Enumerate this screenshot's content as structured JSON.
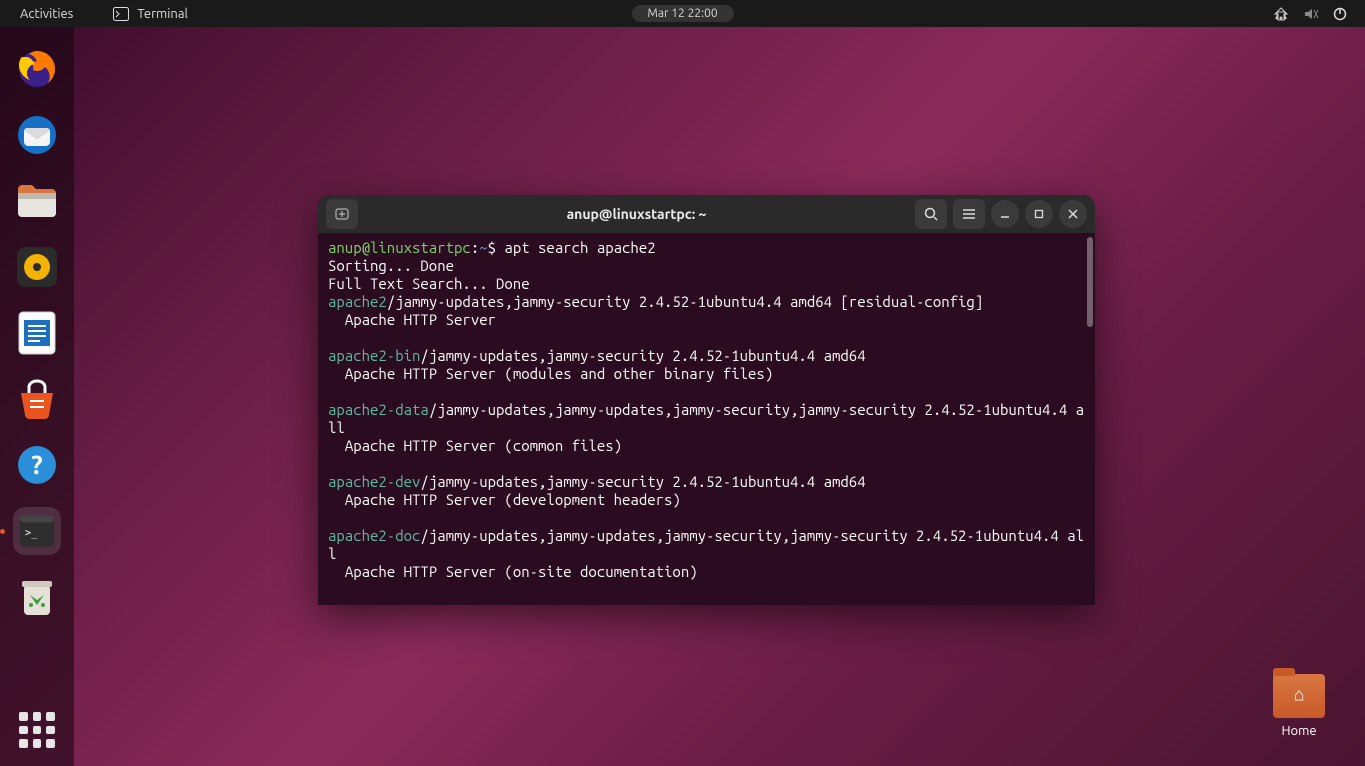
{
  "topbar": {
    "activities": "Activities",
    "app_name": "Terminal",
    "clock": "Mar 12  22:00"
  },
  "dock": {
    "items": [
      {
        "name": "firefox",
        "interactive": true
      },
      {
        "name": "thunderbird",
        "interactive": true
      },
      {
        "name": "files",
        "interactive": true
      },
      {
        "name": "rhythmbox",
        "interactive": true
      },
      {
        "name": "libreoffice-writer",
        "interactive": true
      },
      {
        "name": "ubuntu-software",
        "interactive": true
      },
      {
        "name": "help",
        "interactive": true
      },
      {
        "name": "terminal",
        "interactive": true,
        "active": true
      },
      {
        "name": "trash",
        "interactive": true
      }
    ]
  },
  "desktop": {
    "home_label": "Home"
  },
  "terminal": {
    "title": "anup@linuxstartpc: ~",
    "prompt": {
      "user_host": "anup@linuxstartpc",
      "sep": ":",
      "path": "~",
      "symbol": "$"
    },
    "command": "apt search apache2",
    "lines": [
      "Sorting... Done",
      "Full Text Search... Done"
    ],
    "results": [
      {
        "pkg": "apache2",
        "meta": "/jammy-updates,jammy-security 2.4.52-1ubuntu4.4 amd64 [residual-config]",
        "desc": "  Apache HTTP Server"
      },
      {
        "pkg": "apache2-bin",
        "meta": "/jammy-updates,jammy-security 2.4.52-1ubuntu4.4 amd64",
        "desc": "  Apache HTTP Server (modules and other binary files)"
      },
      {
        "pkg": "apache2-data",
        "meta": "/jammy-updates,jammy-updates,jammy-security,jammy-security 2.4.52-1ubuntu4.4 all",
        "desc": "  Apache HTTP Server (common files)"
      },
      {
        "pkg": "apache2-dev",
        "meta": "/jammy-updates,jammy-security 2.4.52-1ubuntu4.4 amd64",
        "desc": "  Apache HTTP Server (development headers)"
      },
      {
        "pkg": "apache2-doc",
        "meta": "/jammy-updates,jammy-updates,jammy-security,jammy-security 2.4.52-1ubuntu4.4 all",
        "desc": "  Apache HTTP Server (on-site documentation)"
      }
    ]
  }
}
